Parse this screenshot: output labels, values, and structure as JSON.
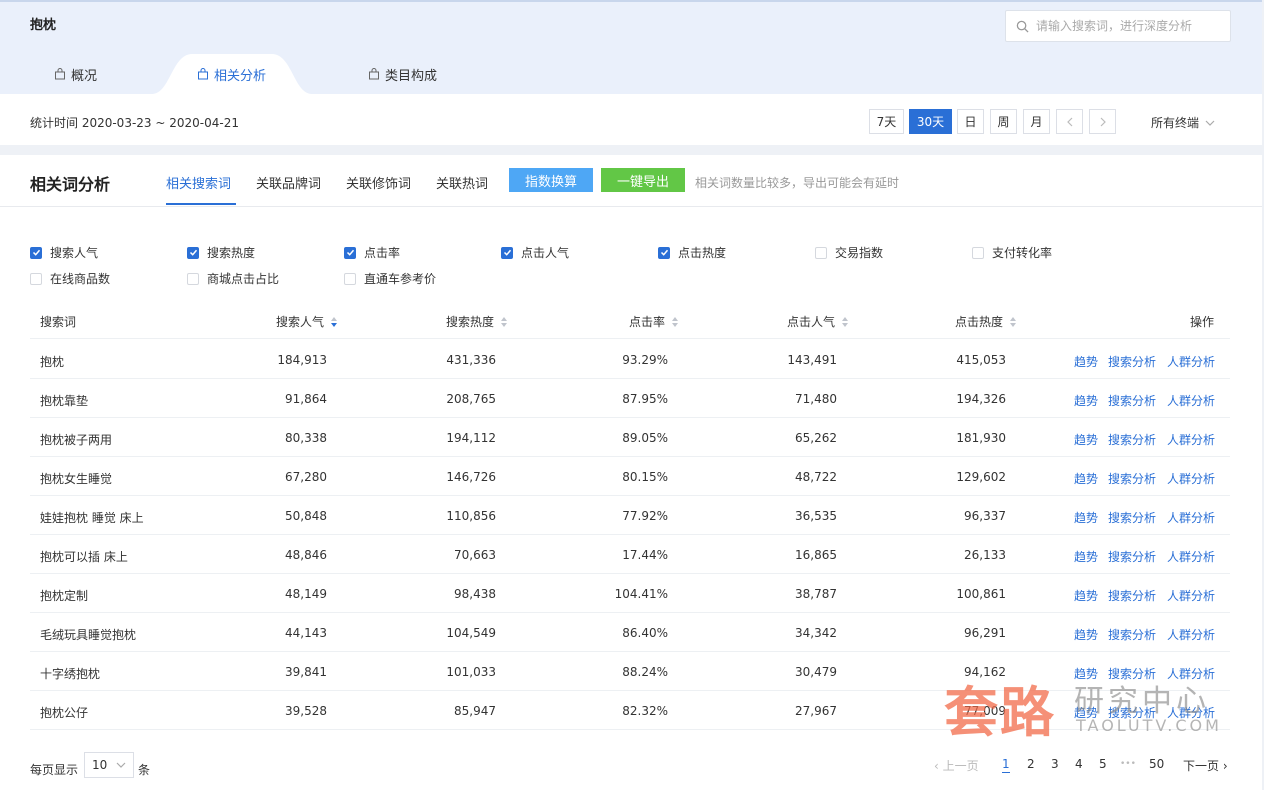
{
  "header": {
    "keyword": "抱枕",
    "search": {
      "placeholder": "请输入搜索词，进行深度分析"
    },
    "tabs": [
      {
        "label": "概况"
      },
      {
        "label": "相关分析"
      },
      {
        "label": "类目构成"
      }
    ],
    "stat_time": "统计时间 2020-03-23 ~ 2020-04-21",
    "periods": [
      "7天",
      "30天",
      "日",
      "周",
      "月"
    ],
    "active_period": "30天",
    "terminal": "所有终端"
  },
  "analysis": {
    "title": "相关词分析",
    "subtabs": [
      {
        "label": "相关搜索词"
      },
      {
        "label": "关联品牌词"
      },
      {
        "label": "关联修饰词"
      },
      {
        "label": "关联热词"
      }
    ],
    "index_button": "指数换算",
    "export_button": "一键导出",
    "export_note": "相关词数量比较多，导出可能会有延时",
    "metrics": [
      {
        "label": "搜索人气",
        "checked": true
      },
      {
        "label": "搜索热度",
        "checked": true
      },
      {
        "label": "点击率",
        "checked": true
      },
      {
        "label": "点击人气",
        "checked": true
      },
      {
        "label": "点击热度",
        "checked": true
      },
      {
        "label": "交易指数",
        "checked": false
      },
      {
        "label": "支付转化率",
        "checked": false
      },
      {
        "label": "在线商品数",
        "checked": false
      },
      {
        "label": "商城点击占比",
        "checked": false
      },
      {
        "label": "直通车参考价",
        "checked": false
      }
    ]
  },
  "table": {
    "columns": [
      "搜索词",
      "搜索人气",
      "搜索热度",
      "点击率",
      "点击人气",
      "点击热度",
      "操作"
    ],
    "actions": [
      "趋势",
      "搜索分析",
      "人群分析"
    ],
    "rows": [
      [
        "抱枕",
        "184,913",
        "431,336",
        "93.29%",
        "143,491",
        "415,053"
      ],
      [
        "抱枕靠垫",
        "91,864",
        "208,765",
        "87.95%",
        "71,480",
        "194,326"
      ],
      [
        "抱枕被子两用",
        "80,338",
        "194,112",
        "89.05%",
        "65,262",
        "181,930"
      ],
      [
        "抱枕女生睡觉",
        "67,280",
        "146,726",
        "80.15%",
        "48,722",
        "129,602"
      ],
      [
        "娃娃抱枕 睡觉 床上",
        "50,848",
        "110,856",
        "77.92%",
        "36,535",
        "96,337"
      ],
      [
        "抱枕可以插 床上",
        "48,846",
        "70,663",
        "17.44%",
        "16,865",
        "26,133"
      ],
      [
        "抱枕定制",
        "48,149",
        "98,438",
        "104.41%",
        "38,787",
        "100,861"
      ],
      [
        "毛绒玩具睡觉抱枕",
        "44,143",
        "104,549",
        "86.40%",
        "34,342",
        "96,291"
      ],
      [
        "十字绣抱枕",
        "39,841",
        "101,033",
        "88.24%",
        "30,479",
        "94,162"
      ],
      [
        "抱枕公仔",
        "39,528",
        "85,947",
        "82.32%",
        "27,967",
        "77,009"
      ]
    ]
  },
  "pagination": {
    "per_page_label": "每页显示",
    "per_page_value": "10",
    "per_page_unit": "条",
    "prev": "上一页",
    "pages": [
      "1",
      "2",
      "3",
      "4",
      "5"
    ],
    "ellipsis": "•••",
    "last": "50",
    "next": "下一页"
  },
  "watermark": {
    "main": "套路",
    "sub": "研究中心",
    "url": "TAOLUTV.COM"
  },
  "colors": {
    "accent": "#2a6fd6",
    "index_button": "#4ea7f5",
    "export_button": "#62c746",
    "watermark": "#f26b4a"
  }
}
